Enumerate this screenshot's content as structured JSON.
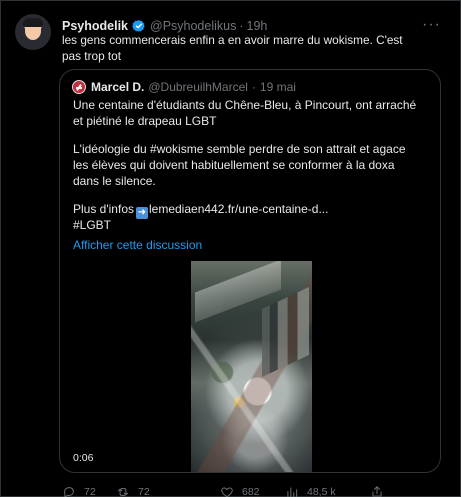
{
  "tweet": {
    "display_name": "Psyhodelik",
    "handle": "@Psyhodelikus",
    "separator": "·",
    "time": "19h",
    "text": "les gens commencerais enfin a en avoir marre du wokisme. C'est pas trop tot",
    "more_icon": "more-horizontal-icon",
    "verified_icon": "verified-badge-icon"
  },
  "quote": {
    "display_name": "Marcel D.",
    "handle": "@DubreuilhMarcel",
    "separator": "·",
    "date": "19 mai",
    "paragraph_1": "Une centaine d'étudiants du Chêne-Bleu, à Pincourt, ont arraché et piétiné le drapeau LGBT",
    "paragraph_2": "L'idéologie du #wokisme semble perdre de son attrait et agace les élèves qui doivent habituellement se conformer à la doxa dans le silence.",
    "more_info_prefix": "Plus d'infos",
    "link_arrow_icon": "right-arrow-icon",
    "link": "lemediaen442.fr/une-centaine-d...",
    "hashtag": "#LGBT",
    "show_thread": "Afficher cette discussion",
    "video_duration": "0:06"
  },
  "actions": {
    "reply_count": "72",
    "retweet_count": "72",
    "like_count": "682",
    "view_count": "48,5 k",
    "reply_icon": "reply-icon",
    "retweet_icon": "retweet-icon",
    "like_icon": "heart-icon",
    "views_icon": "views-chart-icon",
    "share_icon": "share-icon"
  },
  "colors": {
    "background": "#000000",
    "text": "#e7e9ea",
    "muted": "#71767b",
    "border": "#2f3336",
    "link": "#1d9bf0",
    "verified": "#1d9bf0",
    "quote_avatar": "#c22f3f"
  }
}
